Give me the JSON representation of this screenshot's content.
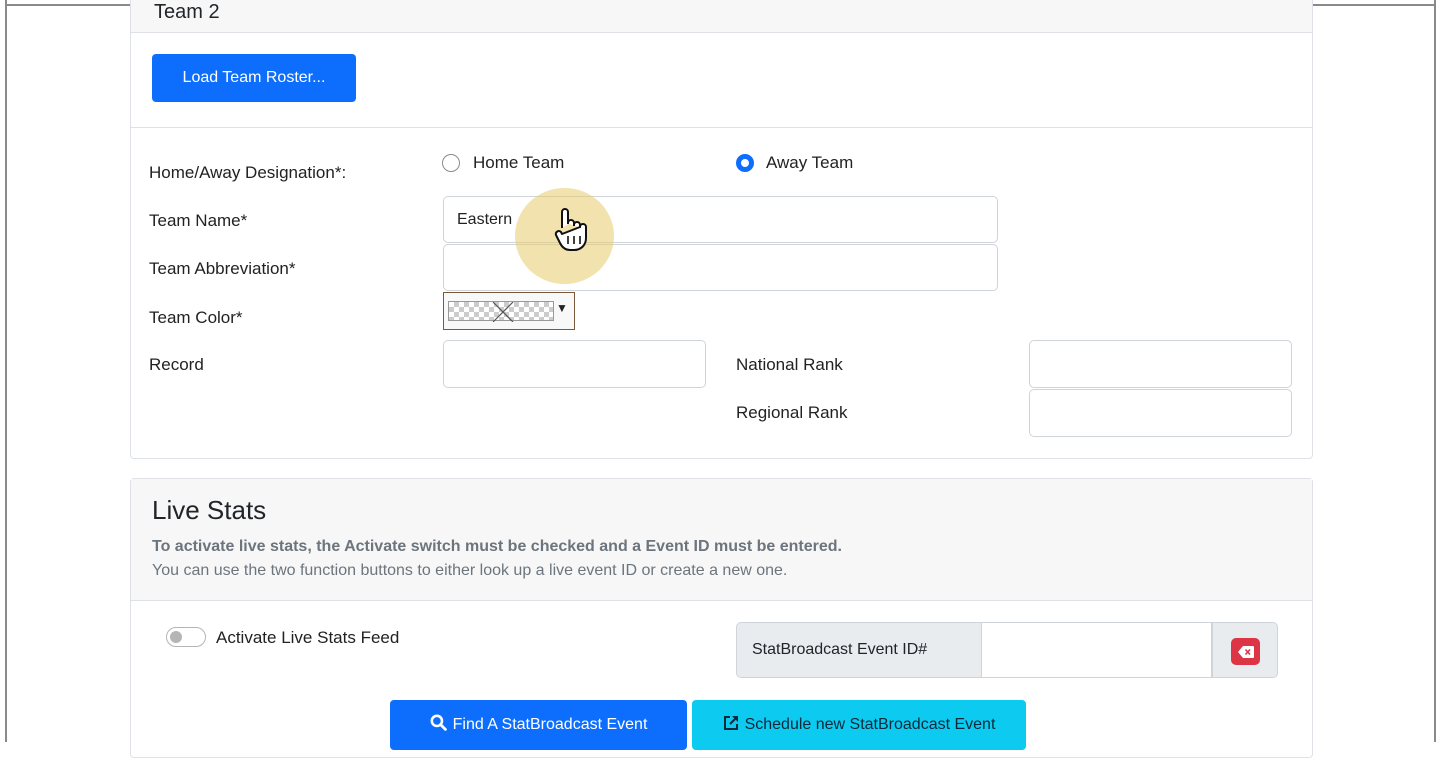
{
  "team2": {
    "title": "Team 2",
    "load_roster_label": "Load Team Roster...",
    "home_away": {
      "label": "Home/Away Designation*:",
      "options": [
        {
          "label": "Home Team",
          "checked": false
        },
        {
          "label": "Away Team",
          "checked": true
        }
      ]
    },
    "team_name": {
      "label": "Team Name*",
      "value": "Eastern"
    },
    "team_abbreviation": {
      "label": "Team Abbreviation*",
      "value": ""
    },
    "team_color": {
      "label": "Team Color*",
      "value": "transparent"
    },
    "record": {
      "label": "Record",
      "value": ""
    },
    "national_rank": {
      "label": "National Rank",
      "value": ""
    },
    "regional_rank": {
      "label": "Regional Rank",
      "value": ""
    }
  },
  "live_stats": {
    "title": "Live Stats",
    "description_bold": "To activate live stats, the Activate switch must be checked and a Event ID must be entered.",
    "description": "You can use the two function buttons to either look up a live event ID or create a new one.",
    "activate_label": "Activate Live Stats Feed",
    "activate_on": false,
    "event_id_label": "StatBroadcast Event ID#",
    "event_id_value": "",
    "find_button_label": "Find A StatBroadcast Event",
    "schedule_button_label": "Schedule new StatBroadcast Event"
  },
  "icons": {
    "find": "search-icon",
    "schedule": "external-link-icon",
    "clear": "backspace-icon",
    "cursor": "hand-pointer-icon"
  },
  "colors": {
    "primary": "#0d6efd",
    "info": "#0dcaf0",
    "danger": "#dc3545",
    "cursor_highlight": "#e8cb6b"
  }
}
